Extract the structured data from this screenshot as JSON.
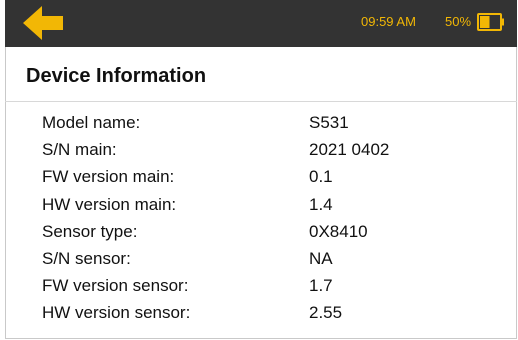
{
  "status_bar": {
    "time": "09:59 AM",
    "battery_percent": "50%",
    "battery_level": 0.5,
    "accent_color": "#f2b705",
    "background_color": "#333333"
  },
  "back_button": {
    "icon": "arrow-left-icon"
  },
  "page_title": "Device Information",
  "device_info": [
    {
      "label": "Model name:",
      "value": "S531"
    },
    {
      "label": "S/N main:",
      "value": "2021 0402"
    },
    {
      "label": "FW version main:",
      "value": "0.1"
    },
    {
      "label": "HW version main:",
      "value": "1.4"
    },
    {
      "label": "Sensor type:",
      "value": "0X8410"
    },
    {
      "label": "S/N sensor:",
      "value": "NA"
    },
    {
      "label": "FW version sensor:",
      "value": "1.7"
    },
    {
      "label": "HW version sensor:",
      "value": "2.55"
    }
  ]
}
